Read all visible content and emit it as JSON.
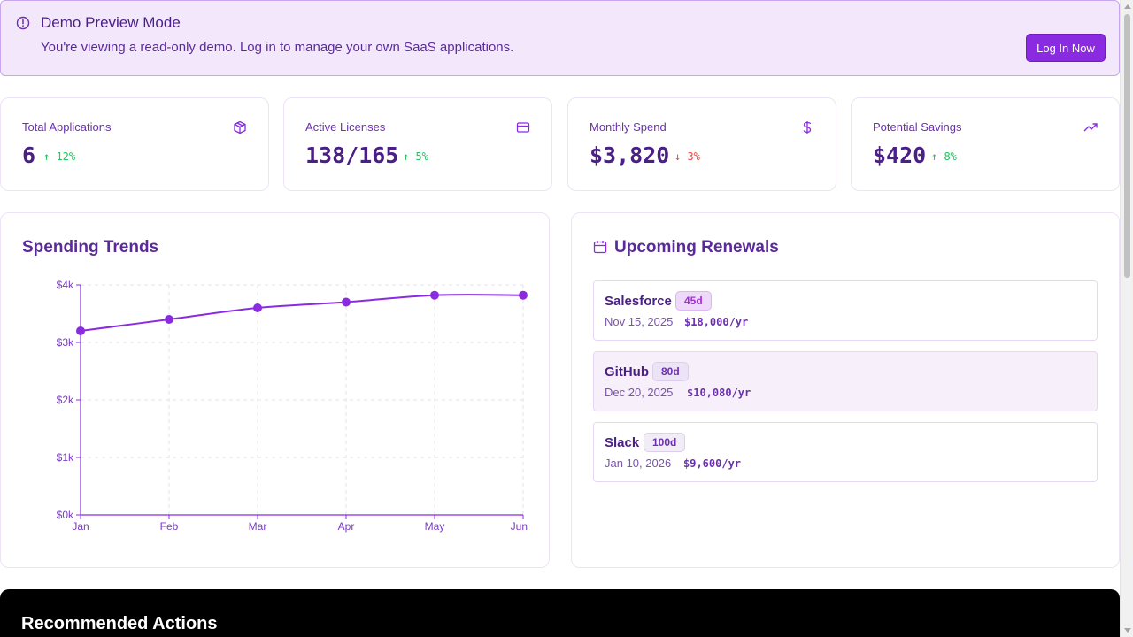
{
  "banner": {
    "title": "Demo Preview Mode",
    "description": "You're viewing a read-only demo. Log in to manage your own SaaS applications.",
    "login_label": "Log In Now"
  },
  "stats": [
    {
      "label": "Total Applications",
      "value": "6",
      "delta": "12%",
      "direction": "up",
      "icon": "cube-icon"
    },
    {
      "label": "Active Licenses",
      "value": "138/165",
      "delta": "5%",
      "direction": "up",
      "icon": "credit-card-icon"
    },
    {
      "label": "Monthly Spend",
      "value": "$3,820",
      "delta": "3%",
      "direction": "down",
      "icon": "dollar-icon"
    },
    {
      "label": "Potential Savings",
      "value": "$420",
      "delta": "8%",
      "direction": "up",
      "icon": "trending-up-icon"
    }
  ],
  "spending": {
    "title": "Spending Trends"
  },
  "chart_data": {
    "type": "line",
    "categories": [
      "Jan",
      "Feb",
      "Mar",
      "Apr",
      "May",
      "Jun"
    ],
    "values": [
      3200,
      3400,
      3600,
      3700,
      3820,
      3820
    ],
    "ylim": [
      0,
      4000
    ],
    "yticks": [
      0,
      1000,
      2000,
      3000,
      4000
    ],
    "ytick_labels": [
      "$0k",
      "$1k",
      "$2k",
      "$3k",
      "$4k"
    ],
    "grid": true,
    "color": "#8a2be2"
  },
  "renewals": {
    "title": "Upcoming Renewals",
    "items": [
      {
        "name": "Salesforce",
        "days": "45d",
        "date": "Nov 15, 2025",
        "amount": "$18,000/yr"
      },
      {
        "name": "GitHub",
        "days": "80d",
        "date": "Dec 20, 2025",
        "amount": "$10,080/yr"
      },
      {
        "name": "Slack",
        "days": "100d",
        "date": "Jan 10, 2026",
        "amount": "$9,600/yr"
      }
    ]
  },
  "actions": {
    "title": "Recommended Actions"
  }
}
